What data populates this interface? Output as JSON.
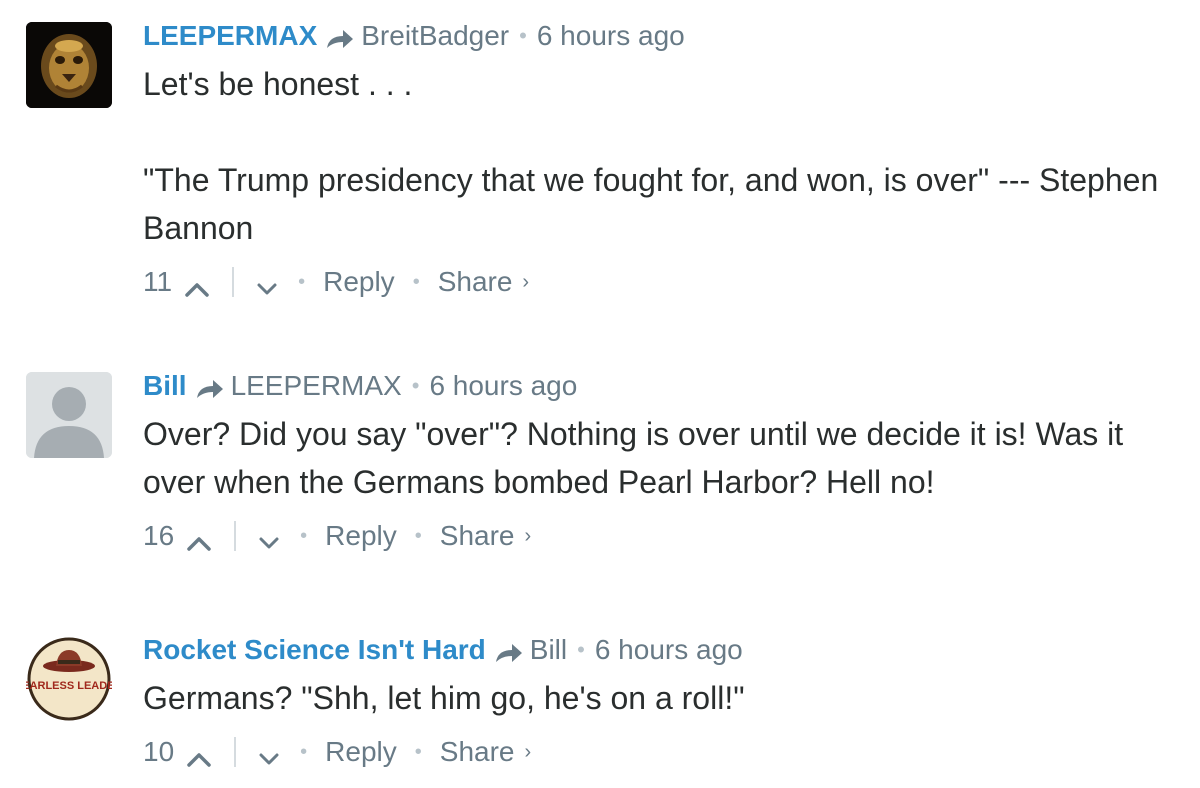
{
  "comments": [
    {
      "avatar_icon": "lion-head-avatar-icon",
      "author": "LEEPERMAX",
      "reply_icon": "reply-arrow-icon",
      "parent": "BreitBadger",
      "time": "6 hours ago",
      "body": [
        "Let's be honest . . .",
        "\"The Trump presidency that we fought for, and won, is over\" --- Stephen Bannon"
      ],
      "votes": "11",
      "reply_label": "Reply",
      "share_label": "Share",
      "share_chevron": "›"
    },
    {
      "avatar_icon": "default-user-avatar-icon",
      "author": "Bill",
      "reply_icon": "reply-arrow-icon",
      "parent": "LEEPERMAX",
      "time": "6 hours ago",
      "body": [
        "Over? Did you say \"over\"? Nothing is over until we decide it is! Was it over when the Germans bombed Pearl Harbor? Hell no!"
      ],
      "votes": "16",
      "reply_label": "Reply",
      "share_label": "Share",
      "share_chevron": "›"
    },
    {
      "avatar_icon": "fearless-leader-badge-icon",
      "avatar_text": "FEARLESS LEADER",
      "author": "Rocket Science Isn't Hard",
      "reply_icon": "reply-arrow-icon",
      "parent": "Bill",
      "time": "6 hours ago",
      "body": [
        "Germans? \"Shh, let him go, he's on a roll!\""
      ],
      "votes": "10",
      "reply_label": "Reply",
      "share_label": "Share",
      "share_chevron": "›"
    }
  ],
  "separator_dot": "•",
  "colors": {
    "author": "#2e8bc9",
    "meta": "#687a86",
    "body_text": "#2a2e2e",
    "dot": "#b7c2c9"
  }
}
